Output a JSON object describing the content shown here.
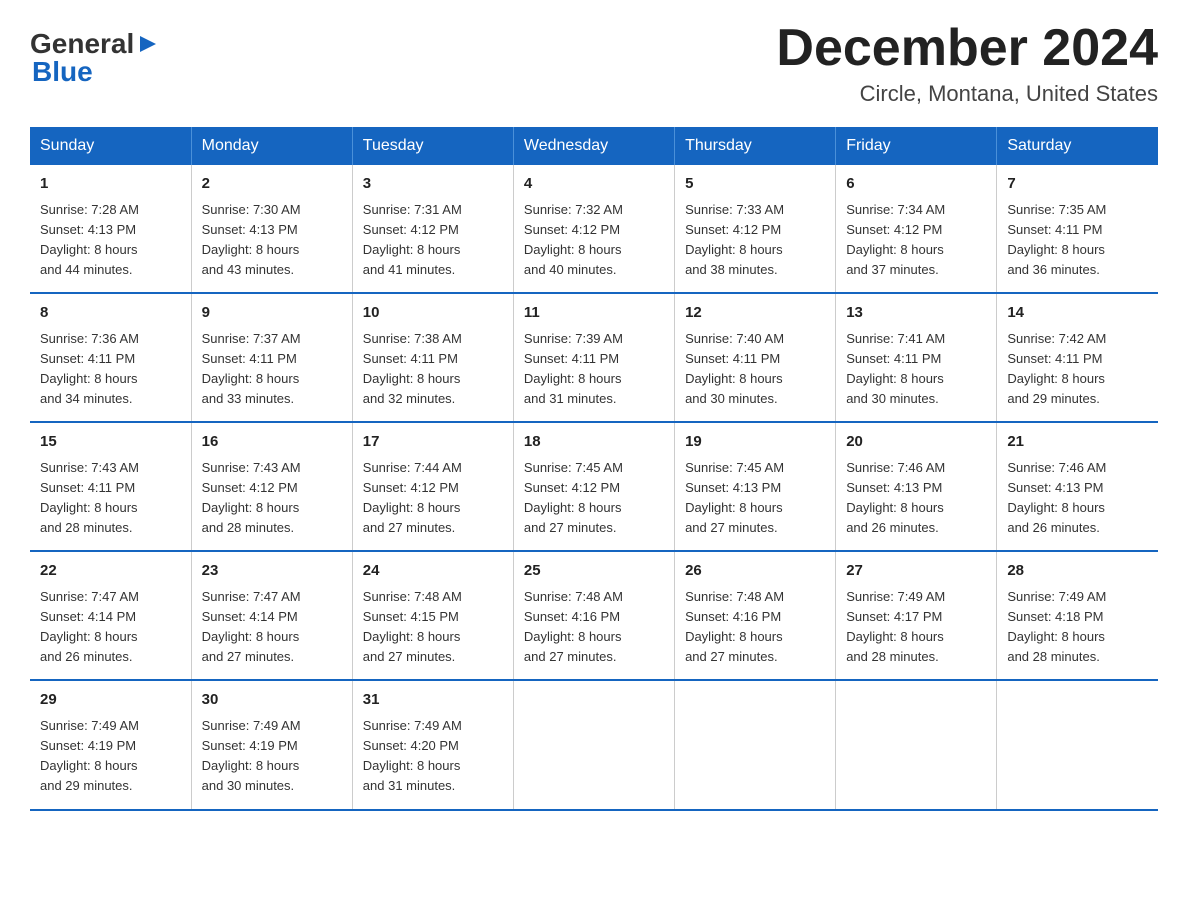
{
  "header": {
    "logo_general": "General",
    "logo_blue": "Blue",
    "month_title": "December 2024",
    "location": "Circle, Montana, United States"
  },
  "weekdays": [
    "Sunday",
    "Monday",
    "Tuesday",
    "Wednesday",
    "Thursday",
    "Friday",
    "Saturday"
  ],
  "weeks": [
    [
      {
        "day": "1",
        "sunrise": "7:28 AM",
        "sunset": "4:13 PM",
        "daylight": "8 hours and 44 minutes."
      },
      {
        "day": "2",
        "sunrise": "7:30 AM",
        "sunset": "4:13 PM",
        "daylight": "8 hours and 43 minutes."
      },
      {
        "day": "3",
        "sunrise": "7:31 AM",
        "sunset": "4:12 PM",
        "daylight": "8 hours and 41 minutes."
      },
      {
        "day": "4",
        "sunrise": "7:32 AM",
        "sunset": "4:12 PM",
        "daylight": "8 hours and 40 minutes."
      },
      {
        "day": "5",
        "sunrise": "7:33 AM",
        "sunset": "4:12 PM",
        "daylight": "8 hours and 38 minutes."
      },
      {
        "day": "6",
        "sunrise": "7:34 AM",
        "sunset": "4:12 PM",
        "daylight": "8 hours and 37 minutes."
      },
      {
        "day": "7",
        "sunrise": "7:35 AM",
        "sunset": "4:11 PM",
        "daylight": "8 hours and 36 minutes."
      }
    ],
    [
      {
        "day": "8",
        "sunrise": "7:36 AM",
        "sunset": "4:11 PM",
        "daylight": "8 hours and 34 minutes."
      },
      {
        "day": "9",
        "sunrise": "7:37 AM",
        "sunset": "4:11 PM",
        "daylight": "8 hours and 33 minutes."
      },
      {
        "day": "10",
        "sunrise": "7:38 AM",
        "sunset": "4:11 PM",
        "daylight": "8 hours and 32 minutes."
      },
      {
        "day": "11",
        "sunrise": "7:39 AM",
        "sunset": "4:11 PM",
        "daylight": "8 hours and 31 minutes."
      },
      {
        "day": "12",
        "sunrise": "7:40 AM",
        "sunset": "4:11 PM",
        "daylight": "8 hours and 30 minutes."
      },
      {
        "day": "13",
        "sunrise": "7:41 AM",
        "sunset": "4:11 PM",
        "daylight": "8 hours and 30 minutes."
      },
      {
        "day": "14",
        "sunrise": "7:42 AM",
        "sunset": "4:11 PM",
        "daylight": "8 hours and 29 minutes."
      }
    ],
    [
      {
        "day": "15",
        "sunrise": "7:43 AM",
        "sunset": "4:11 PM",
        "daylight": "8 hours and 28 minutes."
      },
      {
        "day": "16",
        "sunrise": "7:43 AM",
        "sunset": "4:12 PM",
        "daylight": "8 hours and 28 minutes."
      },
      {
        "day": "17",
        "sunrise": "7:44 AM",
        "sunset": "4:12 PM",
        "daylight": "8 hours and 27 minutes."
      },
      {
        "day": "18",
        "sunrise": "7:45 AM",
        "sunset": "4:12 PM",
        "daylight": "8 hours and 27 minutes."
      },
      {
        "day": "19",
        "sunrise": "7:45 AM",
        "sunset": "4:13 PM",
        "daylight": "8 hours and 27 minutes."
      },
      {
        "day": "20",
        "sunrise": "7:46 AM",
        "sunset": "4:13 PM",
        "daylight": "8 hours and 26 minutes."
      },
      {
        "day": "21",
        "sunrise": "7:46 AM",
        "sunset": "4:13 PM",
        "daylight": "8 hours and 26 minutes."
      }
    ],
    [
      {
        "day": "22",
        "sunrise": "7:47 AM",
        "sunset": "4:14 PM",
        "daylight": "8 hours and 26 minutes."
      },
      {
        "day": "23",
        "sunrise": "7:47 AM",
        "sunset": "4:14 PM",
        "daylight": "8 hours and 27 minutes."
      },
      {
        "day": "24",
        "sunrise": "7:48 AM",
        "sunset": "4:15 PM",
        "daylight": "8 hours and 27 minutes."
      },
      {
        "day": "25",
        "sunrise": "7:48 AM",
        "sunset": "4:16 PM",
        "daylight": "8 hours and 27 minutes."
      },
      {
        "day": "26",
        "sunrise": "7:48 AM",
        "sunset": "4:16 PM",
        "daylight": "8 hours and 27 minutes."
      },
      {
        "day": "27",
        "sunrise": "7:49 AM",
        "sunset": "4:17 PM",
        "daylight": "8 hours and 28 minutes."
      },
      {
        "day": "28",
        "sunrise": "7:49 AM",
        "sunset": "4:18 PM",
        "daylight": "8 hours and 28 minutes."
      }
    ],
    [
      {
        "day": "29",
        "sunrise": "7:49 AM",
        "sunset": "4:19 PM",
        "daylight": "8 hours and 29 minutes."
      },
      {
        "day": "30",
        "sunrise": "7:49 AM",
        "sunset": "4:19 PM",
        "daylight": "8 hours and 30 minutes."
      },
      {
        "day": "31",
        "sunrise": "7:49 AM",
        "sunset": "4:20 PM",
        "daylight": "8 hours and 31 minutes."
      },
      null,
      null,
      null,
      null
    ]
  ],
  "labels": {
    "sunrise": "Sunrise:",
    "sunset": "Sunset:",
    "daylight": "Daylight:"
  },
  "colors": {
    "header_bg": "#1565c0",
    "border_blue": "#1565c0"
  }
}
